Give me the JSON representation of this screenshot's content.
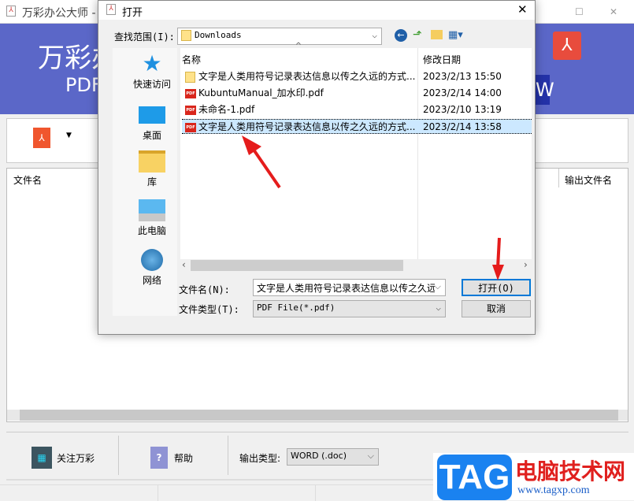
{
  "app": {
    "title": "万彩办公大师 - P",
    "banner_title": "万彩办",
    "banner_sub": "PDF",
    "banner_icon_letter": "W",
    "columns": [
      "文件名",
      "输出文件名"
    ],
    "bottom": {
      "follow": "关注万彩",
      "help": "帮助",
      "output_type_label": "输出类型:",
      "output_type_value": "WORD (.doc)"
    },
    "colors": {
      "banner": "#5b67c8",
      "accent": "#e84c3d"
    }
  },
  "dialog": {
    "title": "打开",
    "look_in_label": "查找范围(I):",
    "look_in_value": "Downloads",
    "places": [
      {
        "label": "快速访问",
        "icon": "star-icon"
      },
      {
        "label": "桌面",
        "icon": "desktop-icon"
      },
      {
        "label": "库",
        "icon": "library-icon"
      },
      {
        "label": "此电脑",
        "icon": "computer-icon"
      },
      {
        "label": "网络",
        "icon": "network-icon"
      }
    ],
    "columns": {
      "name": "名称",
      "date": "修改日期"
    },
    "files": [
      {
        "name": "文字是人类用符号记录表达信息以传之久远的方式...",
        "date": "2023/2/13 15:50",
        "type": "folder"
      },
      {
        "name": "KubuntuManual_加水印.pdf",
        "date": "2023/2/14 14:00",
        "type": "pdf"
      },
      {
        "name": "未命名-1.pdf",
        "date": "2023/2/10 13:19",
        "type": "pdf"
      },
      {
        "name": "文字是人类用符号记录表达信息以传之久远的方式...",
        "date": "2023/2/14 13:58",
        "type": "pdf",
        "selected": true
      }
    ],
    "filename_label": "文件名(N):",
    "filename_value": "文字是人类用符号记录表达信息以传之久远",
    "filetype_label": "文件类型(T):",
    "filetype_value": "PDF File(*.pdf)",
    "open": "打开(O)",
    "cancel": "取消"
  },
  "watermark": {
    "logo": "TAG",
    "site_name": "电脑技术网",
    "url": "www.tagxp.com"
  }
}
